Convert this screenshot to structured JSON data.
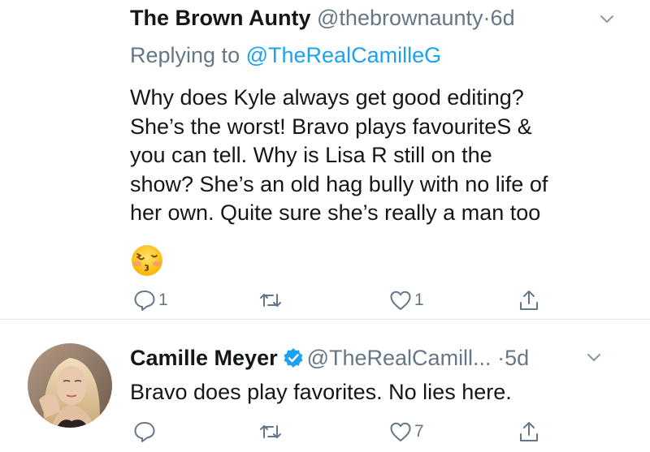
{
  "tweets": [
    {
      "name": "The Brown Aunty",
      "handle": "@thebrownaunty",
      "separator": "·",
      "time": "6d",
      "replying_prefix": "Replying to",
      "replying_to": "@TheRealCamilleG",
      "lines": [
        "Why does Kyle always get good editing?",
        "She’s the worst! Bravo plays favouriteS &",
        "you can tell. Why is Lisa R still on the",
        "show? She’s an old hag bully with no life of",
        "her own. Quite sure she’s really a man too"
      ],
      "emoji": "kissing-face-closed-eyes",
      "reply_count": "1",
      "retweet_count": "",
      "like_count": "1"
    },
    {
      "name": "Camille Meyer",
      "verified": true,
      "handle": "@TheRealCamill...",
      "separator": "·",
      "time": "5d",
      "text": "Bravo does play favorites. No lies here.",
      "reply_count": "",
      "retweet_count": "",
      "like_count": "7"
    }
  ],
  "colors": {
    "text": "#14171a",
    "secondary": "#657786",
    "link": "#1da1f2",
    "verified": "#1da1f2",
    "divider": "#e1e8ed"
  },
  "icons": [
    "reply-icon",
    "retweet-icon",
    "like-icon",
    "share-icon",
    "chevron-down-icon",
    "verified-badge-icon"
  ]
}
